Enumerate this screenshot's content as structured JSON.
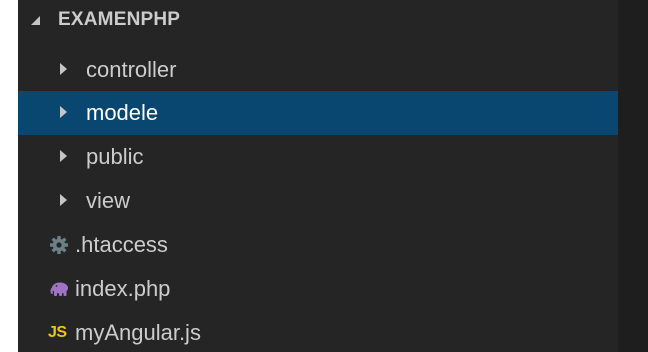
{
  "explorer": {
    "section": {
      "title": "EXAMENPHP"
    },
    "items": [
      {
        "label": "controller",
        "type": "folder"
      },
      {
        "label": "modele",
        "type": "folder",
        "selected": true
      },
      {
        "label": "public",
        "type": "folder"
      },
      {
        "label": "view",
        "type": "folder"
      },
      {
        "label": ".htaccess",
        "type": "file",
        "icon": "gear-icon"
      },
      {
        "label": "index.php",
        "type": "file",
        "icon": "php-elephant-icon"
      },
      {
        "label": "myAngular.js",
        "type": "file",
        "icon": "js-icon",
        "icon_text": "JS"
      }
    ]
  },
  "colors": {
    "sidebar_bg": "#252526",
    "selection_bg": "#094771",
    "text": "#cccccc",
    "editor_bg": "#1e1e1e",
    "gear": "#6d8086",
    "php": "#a074c4",
    "js": "#f0c419"
  }
}
